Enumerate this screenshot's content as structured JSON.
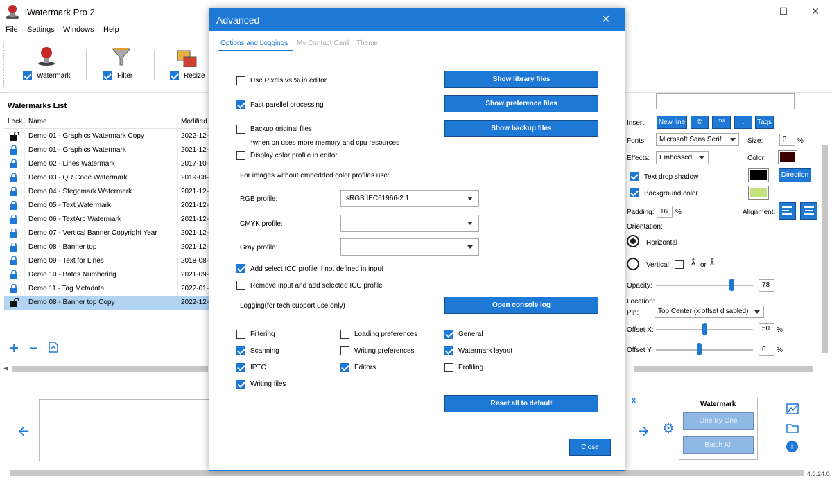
{
  "app": {
    "title": "iWatermark Pro 2",
    "version": "4.0.24.0"
  },
  "menu": [
    "File",
    "Settings",
    "Windows",
    "Help"
  ],
  "toolbar": {
    "watermark": "Watermark",
    "filter": "Filter",
    "resize": "Resize"
  },
  "list": {
    "title": "Watermarks List",
    "col_lock": "Lock",
    "col_name": "Name",
    "col_modified": "Modified",
    "rows": [
      {
        "name": "Demo 01 - Graphics Watermark Copy",
        "date": "2022-12-"
      },
      {
        "name": "Demo 01 - Graphics Watermark",
        "date": "2021-12-"
      },
      {
        "name": "Demo 02 - Lines Watermark",
        "date": "2017-10-"
      },
      {
        "name": "Demo 03 - QR Code Watermark",
        "date": "2019-08-"
      },
      {
        "name": "Demo 04 - Stegomark Watermark",
        "date": "2021-12-"
      },
      {
        "name": "Demo 05 - Text Watermark",
        "date": "2021-12-"
      },
      {
        "name": "Demo 06 - TextArc Watermark",
        "date": "2021-12-"
      },
      {
        "name": "Demo 07 - Vertical Banner Copyright Year",
        "date": "2021-12-"
      },
      {
        "name": "Demo 08 - Banner top",
        "date": "2021-12-"
      },
      {
        "name": "Demo 09 - Text for Lines",
        "date": "2018-08-"
      },
      {
        "name": "Demo 10 - Bates Numbering",
        "date": "2021-09-"
      },
      {
        "name": "Demo 11 - Tag Metadata",
        "date": "2022-01-"
      },
      {
        "name": "Demo 08 - Banner top Copy",
        "date": "2022-12-"
      }
    ]
  },
  "panel": {
    "insert": "Insert:",
    "new_line": "New line",
    "copyright": "©",
    "trademark": "™",
    "dot": ".",
    "tags": "Tags",
    "fonts": "Fonts:",
    "font_value": "Microsoft Sans Serif",
    "size": "Size:",
    "size_value": "3",
    "percent": "%",
    "effects": "Effects:",
    "effects_value": "Embossed",
    "color": "Color:",
    "text_drop_shadow": "Text drop shadow",
    "background_color": "Background color",
    "direction": "Direction",
    "padding": "Padding:",
    "padding_value": "16",
    "alignment": "Alignment:",
    "orientation": "Orientation:",
    "horizontal": "Horizontal",
    "vertical": "Vertical",
    "or": "or",
    "opacity": "Opacity:",
    "opacity_value": "78",
    "location": "Location:",
    "pin": "Pin:",
    "pin_value": "Top Center (x offset disabled)",
    "offset_x": "Offset X:",
    "offset_x_value": "50",
    "offset_y": "Offset Y:",
    "offset_y_value": "0",
    "colors": {
      "text_color": "#3a0000",
      "shadow_color": "#000000",
      "bg_color": "#c2e17f"
    }
  },
  "bottom": {
    "watermark": "Watermark",
    "one_by_one": "One By One",
    "batch_all": "Batch All",
    "close_x": "x"
  },
  "dialog": {
    "title": "Advanced",
    "tabs": [
      "Options and Loggings",
      "My Contact Card",
      "Theme"
    ],
    "use_pixels": "Use Pixels vs % in editor",
    "fast_parallel": "Fast parellel processing",
    "backup_original": "Backup original files",
    "backup_note": "*when on uses more memory and cpu resources",
    "display_color_profile": "Display color profile in editor",
    "embedded_profiles_label": "For images without embedded color profiles use:",
    "rgb_profile": "RGB profile:",
    "rgb_value": "sRGB IEC61966-2.1",
    "cmyk_profile": "CMYK profile:",
    "gray_profile": "Gray profile:",
    "add_icc": "Add select ICC profile if not defined in input",
    "remove_icc": "Remove input and add selected ICC profile",
    "logging_label": "Logging(for tech support use only)",
    "show_library": "Show library files",
    "show_preference": "Show preference files",
    "show_backup": "Show backup files",
    "open_console": "Open console log",
    "reset_all": "Reset all to default",
    "close": "Close",
    "log_opts": {
      "filtering": "Filtering",
      "scanning": "Scanning",
      "iptc": "IPTC",
      "writing_files": "Writing files",
      "loading_prefs": "Loading preferences",
      "writing_prefs": "Writing preferences",
      "editors": "Editors",
      "general": "General",
      "watermark_layout": "Watermark layout",
      "profiling": "Profiling"
    }
  }
}
